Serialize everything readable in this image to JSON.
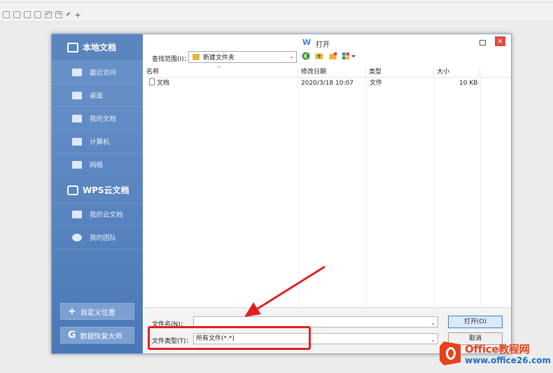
{
  "dialog": {
    "title": "打开",
    "title_icon": "W",
    "close_glyph": "×"
  },
  "sidebar": {
    "local": {
      "label": "本地文档",
      "icon": "monitor-icon"
    },
    "local_items": [
      {
        "label": "最近访问",
        "icon": "recent-icon"
      },
      {
        "label": "桌面",
        "icon": "desktop-icon"
      },
      {
        "label": "我的文档",
        "icon": "documents-icon"
      },
      {
        "label": "计算机",
        "icon": "computer-icon"
      },
      {
        "label": "网络",
        "icon": "network-icon"
      }
    ],
    "cloud": {
      "label": "WPS云文档",
      "icon": "cloud-cube-icon"
    },
    "cloud_items": [
      {
        "label": "我的云文档",
        "icon": "cloud-folder-icon"
      },
      {
        "label": "我的团队",
        "icon": "team-icon"
      }
    ],
    "custom_location": {
      "label": "自定义位置",
      "icon": "+"
    },
    "data_recovery": {
      "label": "数据恢复大师",
      "icon": "G"
    }
  },
  "lookin": {
    "label": "查找范围(I)：",
    "value": "新建文件夹"
  },
  "columns": {
    "name": "名称",
    "modified": "修改日期",
    "type": "类型",
    "size": "大小"
  },
  "files": [
    {
      "name": "文档",
      "modified": "2020/3/18 10:07",
      "type": "文件",
      "size": "10 KB"
    }
  ],
  "footer": {
    "filename_label": "文件名(N)：",
    "filename_value": "",
    "filetype_label": "文件类型(T)：",
    "filetype_value": "所有文件(*.*)",
    "open_button": "打开(O)",
    "cancel_button": "取消"
  },
  "watermark": {
    "brand": "Office教程网",
    "url": "www.office26.com"
  },
  "colors": {
    "accent": "#5a85bf",
    "close": "#e04a3f",
    "highlight": "#e02020",
    "watermark": "#e6421d"
  }
}
